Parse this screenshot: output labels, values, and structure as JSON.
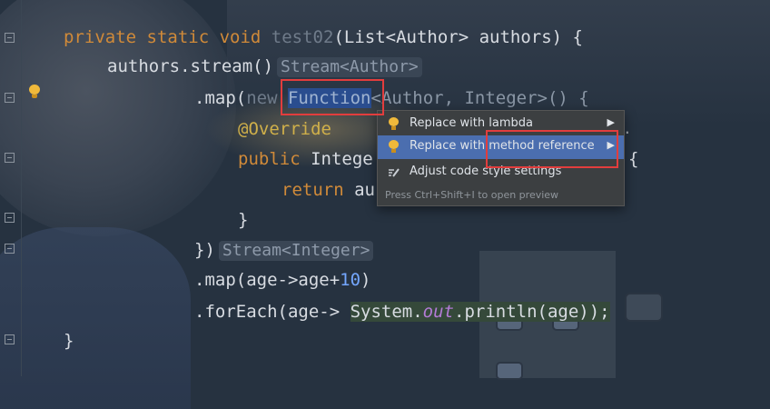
{
  "code": {
    "line1": {
      "modifiers": "private static void",
      "name": "test02",
      "params": "(List<Author> authors) {"
    },
    "line2": {
      "text": "authors.stream()",
      "hint": "Stream<Author>"
    },
    "line3": {
      "prefix": ".map(",
      "new_kw": "new",
      "selected": "Function",
      "suffix": "<Author, Integer>() {"
    },
    "line4": {
      "annotation": "@Override"
    },
    "line5": {
      "public_kw": "public",
      "rest": "Intege",
      "brace": "{"
    },
    "line6": {
      "return_kw": "return",
      "rest": "au"
    },
    "line7": {
      "text": "}"
    },
    "line8": {
      "text": "})",
      "hint": "Stream<Integer>"
    },
    "line9": {
      "prefix": ".map(age->age+",
      "number": "10",
      "suffix": ")"
    },
    "line10": {
      "prefix": ".forEach(age-> ",
      "sys": "System.",
      "out": "out",
      "rest": ".println(age));"
    },
    "line11": {
      "text": "}"
    },
    "stray_dot": "."
  },
  "popup": {
    "items": [
      {
        "label": "Replace with lambda",
        "icon": "bulb-icon",
        "has_submenu": true
      },
      {
        "label": "Replace with method reference",
        "icon": "bulb-icon",
        "has_submenu": true,
        "selected": true
      },
      {
        "label": "Adjust code style settings",
        "icon": "pencil-icon",
        "has_submenu": false
      }
    ],
    "footer": "Press Ctrl+Shift+I to open preview",
    "arrow_glyph": "▶"
  },
  "colors": {
    "keyword": "#d08a39",
    "annotation": "#d0b04a",
    "number": "#74a7ff",
    "selection": "#4b6eaf",
    "highlight_box": "#e23d3d"
  }
}
